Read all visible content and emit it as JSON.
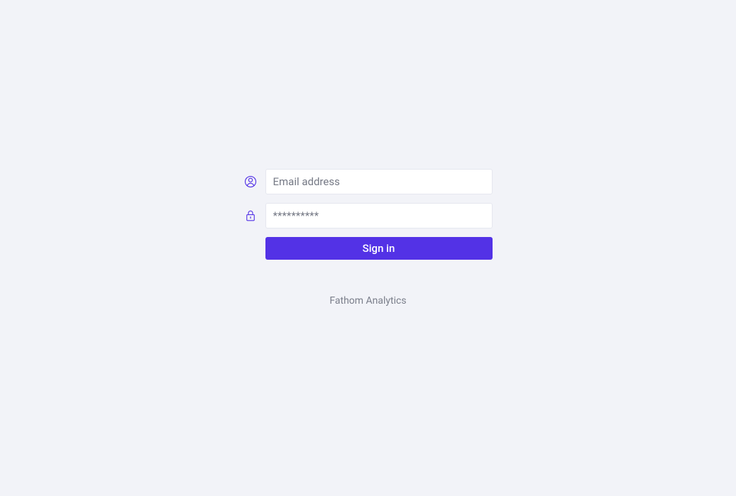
{
  "form": {
    "email": {
      "placeholder": "Email address",
      "value": ""
    },
    "password": {
      "placeholder": "**********",
      "value": ""
    },
    "submit_label": "Sign in"
  },
  "footer": {
    "link_text": "Fathom Analytics"
  },
  "colors": {
    "accent": "#5332e6",
    "background": "#f2f3f8"
  }
}
